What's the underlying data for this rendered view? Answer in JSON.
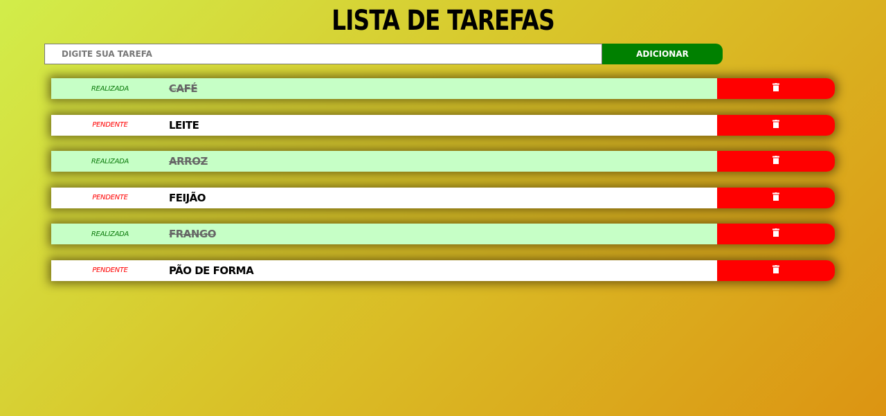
{
  "header": {
    "title": "Lista de Tarefas"
  },
  "form": {
    "input_placeholder": "Digite sua tarefa",
    "input_value": "",
    "add_button_label": "Adicionar"
  },
  "tasks": [
    {
      "status": "Realizada",
      "name": "Café",
      "done": true
    },
    {
      "status": "Pendente",
      "name": "Leite",
      "done": false
    },
    {
      "status": "Realizada",
      "name": "Arroz",
      "done": true
    },
    {
      "status": "Pendente",
      "name": "Feijão",
      "done": false
    },
    {
      "status": "Realizada",
      "name": "Frango",
      "done": true
    },
    {
      "status": "Pendente",
      "name": "Pão de Forma",
      "done": false
    }
  ],
  "icons": {
    "delete": "trash-icon"
  },
  "colors": {
    "add_button": "#008000",
    "delete_button": "#ff0000",
    "done_row": "#c6ffc6",
    "pending_row": "#ffffff",
    "done_status": "#0a7a0a",
    "pending_status": "#ff0000"
  }
}
